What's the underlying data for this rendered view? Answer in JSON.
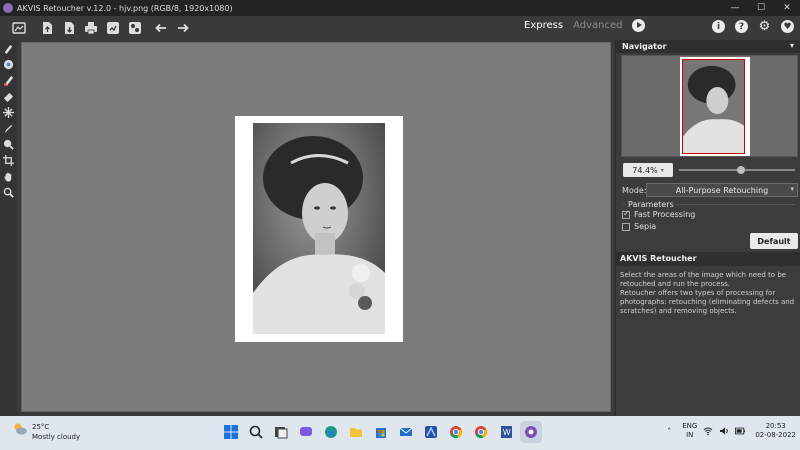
{
  "titlebar": {
    "title": "AKVIS Retoucher v.12.0 - hjv.png (RGB/8, 1920x1080)",
    "minimize": "—",
    "maximize": "☐",
    "close": "✕"
  },
  "toolbar": {
    "buttons": [
      "home-icon",
      "open-icon",
      "save-icon",
      "print-icon",
      "batch-icon",
      "settings-sliders-icon",
      "undo-arrow-icon",
      "redo-arrow-icon"
    ],
    "express_label": "Express",
    "advanced_label": "Advanced",
    "info_icon": "i",
    "help_icon": "?",
    "settings_icon": "⚙",
    "heart_icon": "♥"
  },
  "left_tools": [
    "eraser-brush-icon",
    "globe-icon",
    "selection-brush-icon",
    "eraser-icon",
    "magic-wand-icon",
    "pencil-icon",
    "clone-stamp-icon",
    "crop-icon",
    "hand-icon",
    "zoom-icon"
  ],
  "navigator": {
    "title": "Navigator",
    "zoom": "74.4%",
    "zoom_fraction": 0.5
  },
  "settings": {
    "mode_label": "Mode:",
    "mode_value": "All-Purpose Retouching",
    "params_title": "Parameters",
    "fast_processing_label": "Fast Processing",
    "fast_processing_checked": true,
    "sepia_label": "Sepia",
    "sepia_checked": false,
    "default_button": "Default"
  },
  "info": {
    "title": "AKVIS Retoucher",
    "text1": "Select the areas of the image which need to be retouched and run the process.",
    "text2": "Retoucher offers two types of processing for photographs: retouching (eliminating defects and scratches) and removing objects."
  },
  "taskbar": {
    "temperature": "25°C",
    "weather": "Mostly cloudy",
    "lang1": "ENG",
    "lang2": "IN",
    "time": "20:53",
    "date": "02-08-2022"
  },
  "colors": {
    "canvas": "#7c7c7c",
    "panel": "#3c3c3c",
    "taskbar": "#dfe6ee"
  }
}
